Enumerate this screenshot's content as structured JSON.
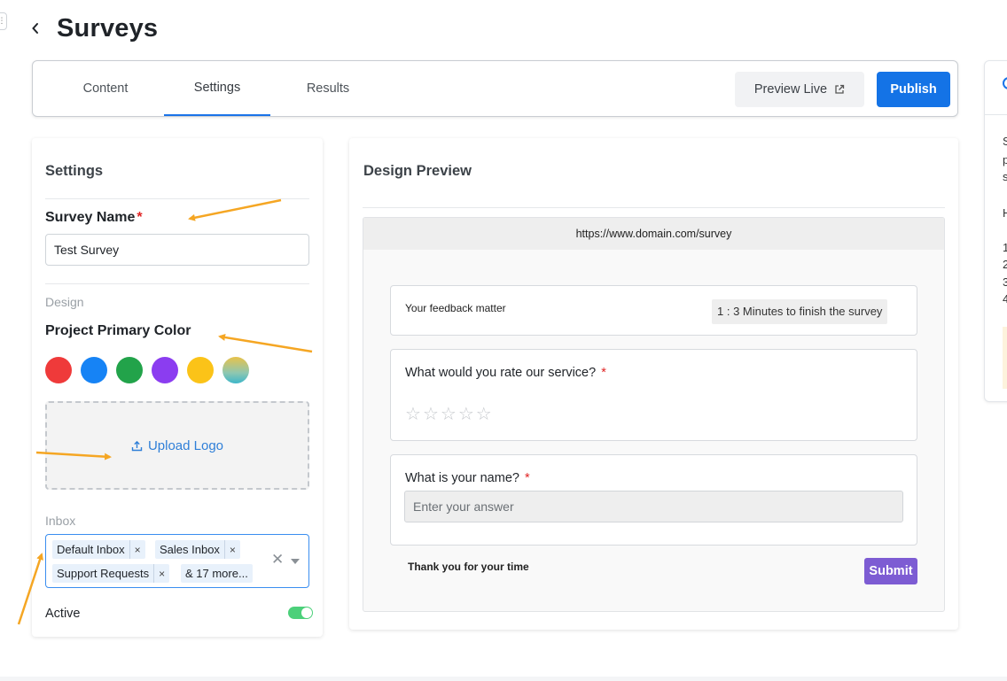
{
  "page": {
    "title": "Surveys"
  },
  "tabs": [
    {
      "label": "Content"
    },
    {
      "label": "Settings",
      "active": true
    },
    {
      "label": "Results"
    }
  ],
  "toolbar": {
    "preview_label": "Preview Live",
    "publish_label": "Publish"
  },
  "settings": {
    "title": "Settings",
    "survey_name_label": "Survey Name",
    "required_mark": "*",
    "survey_name_value": "Test Survey",
    "design_label": "Design",
    "color_label": "Project Primary Color",
    "colors": [
      "#ef3a3a",
      "#1683f5",
      "#22a34a",
      "#8b3df0",
      "#fbc318",
      "gradient-teal-yellow"
    ],
    "upload_label": "Upload Logo",
    "inbox_label": "Inbox",
    "inbox_tags": [
      "Default Inbox",
      "Sales Inbox",
      "Support Requests"
    ],
    "inbox_more": "& 17 more...",
    "active_label": "Active",
    "active_value": true
  },
  "preview": {
    "title": "Design Preview",
    "url": "https://www.domain.com/survey",
    "feedback_text": "Your feedback matter",
    "time_badge": "1 : 3 Minutes to finish the survey",
    "question1": "What would you rate our service?",
    "question2": "What is your name?",
    "answer_placeholder": "Enter your answer",
    "thanks": "Thank you for your time",
    "submit_label": "Submit",
    "rating_stars": 5
  },
  "side_panel": {
    "visible_chars": [
      "S",
      "p",
      "s",
      "H",
      "1",
      "2",
      "3",
      "4"
    ]
  },
  "colors": {
    "accent": "#1473e6",
    "submit": "#7d5cd3",
    "annotation_arrow": "#f5a623",
    "toggle_on": "#4cd07a"
  },
  "icons": [
    "back-chevron-icon",
    "external-link-icon",
    "upload-icon",
    "star-icon",
    "clear-icon",
    "dropdown-caret-icon"
  ]
}
